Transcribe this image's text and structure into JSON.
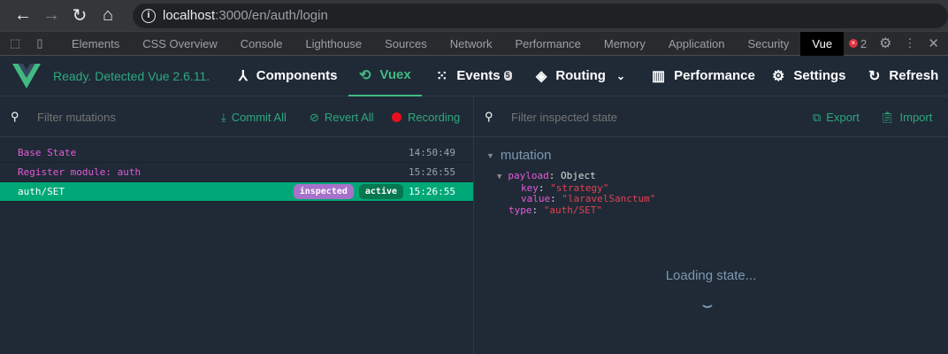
{
  "browser": {
    "url_host": "localhost",
    "url_path": ":3000/en/auth/login"
  },
  "devtools": {
    "tabs": [
      "Elements",
      "CSS Overview",
      "Console",
      "Lighthouse",
      "Sources",
      "Network",
      "Performance",
      "Memory",
      "Application",
      "Security",
      "Vue"
    ],
    "active_tab": "Vue",
    "error_count": "2"
  },
  "vue": {
    "status": "Ready. Detected Vue 2.6.11.",
    "tabs": {
      "components": "Components",
      "vuex": "Vuex",
      "events": "Events",
      "events_badge": "5",
      "routing": "Routing",
      "performance": "Performance",
      "settings": "Settings",
      "refresh": "Refresh"
    }
  },
  "mutations": {
    "filter_placeholder": "Filter mutations",
    "commit_all": "Commit All",
    "revert_all": "Revert All",
    "recording": "Recording",
    "rows": [
      {
        "name": "Base State",
        "time": "14:50:49"
      },
      {
        "name": "Register module: auth",
        "time": "15:26:55"
      },
      {
        "name": "auth/SET",
        "time": "15:26:55",
        "inspected": "inspected",
        "active": "active"
      }
    ]
  },
  "state": {
    "filter_placeholder": "Filter inspected state",
    "export": "Export",
    "import": "Import",
    "section": "mutation",
    "payload_key": "payload",
    "payload_type": "Object",
    "key_label": "key",
    "key_value": "\"strategy\"",
    "value_label": "value",
    "value_value": "\"laravelSanctum\"",
    "type_label": "type",
    "type_value": "\"auth/SET\"",
    "loading": "Loading state..."
  },
  "colors": {
    "accent": "#42b983",
    "selected_row": "#00a878",
    "inspected": "#a772c9",
    "active": "#06774f"
  }
}
